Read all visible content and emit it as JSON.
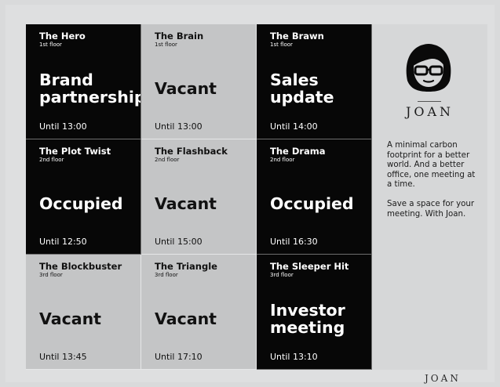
{
  "rooms": [
    {
      "name": "The Hero",
      "floor": "1st floor",
      "status": "Brand partnership",
      "until": "Until 13:00",
      "theme": "black"
    },
    {
      "name": "The Brain",
      "floor": "1st floor",
      "status": "Vacant",
      "until": "Until 13:00",
      "theme": "gray"
    },
    {
      "name": "The Brawn",
      "floor": "1st floor",
      "status": "Sales update",
      "until": "Until 14:00",
      "theme": "black"
    },
    {
      "name": "The Plot Twist",
      "floor": "2nd floor",
      "status": "Occupied",
      "until": "Until 12:50",
      "theme": "black"
    },
    {
      "name": "The Flashback",
      "floor": "2nd floor",
      "status": "Vacant",
      "until": "Until 15:00",
      "theme": "gray"
    },
    {
      "name": "The Drama",
      "floor": "2nd floor",
      "status": "Occupied",
      "until": "Until 16:30",
      "theme": "black"
    },
    {
      "name": "The Blockbuster",
      "floor": "3rd floor",
      "status": "Vacant",
      "until": "Until 13:45",
      "theme": "gray"
    },
    {
      "name": "The Triangle",
      "floor": "3rd floor",
      "status": "Vacant",
      "until": "Until 17:10",
      "theme": "gray"
    },
    {
      "name": "The Sleeper Hit",
      "floor": "3rd floor",
      "status": "Investor meeting",
      "until": "Until 13:10",
      "theme": "black"
    }
  ],
  "sidebar": {
    "logo_text": "JOAN",
    "logo_icon": "woman-with-glasses-icon",
    "blurb_1": "A minimal carbon footprint for a better world. And a better office, one meeting at a time.",
    "blurb_2": "Save a space for your meeting. With Joan."
  },
  "footer": {
    "brand": "JOAN"
  },
  "colors": {
    "occupied_bg": "#070707",
    "vacant_bg": "#c4c5c6",
    "frame": "#dedfe0"
  }
}
